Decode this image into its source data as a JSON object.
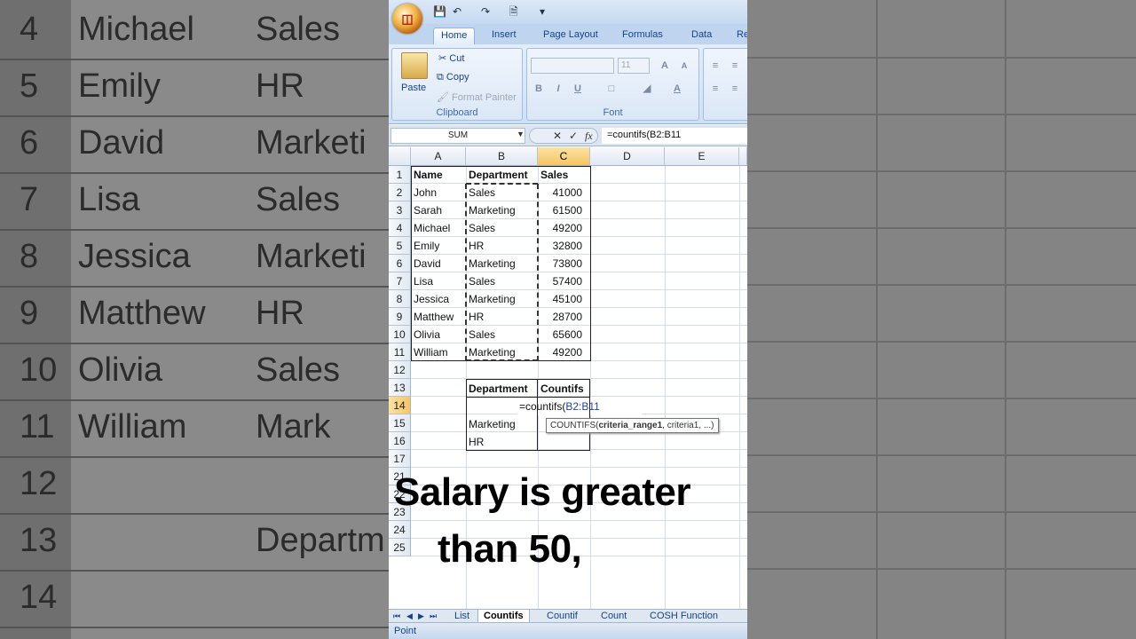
{
  "background": {
    "rows": [
      {
        "num": "4",
        "name": "Michael",
        "dept": "Sales"
      },
      {
        "num": "5",
        "name": "Emily",
        "dept": "HR"
      },
      {
        "num": "6",
        "name": "David",
        "dept": "Marketi"
      },
      {
        "num": "7",
        "name": "Lisa",
        "dept": "Sales"
      },
      {
        "num": "8",
        "name": "Jessica",
        "dept": "Marketi"
      },
      {
        "num": "9",
        "name": "Matthew",
        "dept": "HR"
      },
      {
        "num": "10",
        "name": "Olivia",
        "dept": "Sales"
      },
      {
        "num": "11",
        "name": "William",
        "dept": "Mark"
      },
      {
        "num": "12",
        "name": "",
        "dept": ""
      },
      {
        "num": "13",
        "name": "",
        "dept": "Departm"
      },
      {
        "num": "14",
        "name": "",
        "dept": ""
      }
    ]
  },
  "ribbon": {
    "tabs": [
      "Home",
      "Insert",
      "Page Layout",
      "Formulas",
      "Data",
      "Re"
    ],
    "clipboard": {
      "paste": "Paste",
      "cut": "Cut",
      "copy": "Copy",
      "format_painter": "Format Painter",
      "label": "Clipboard"
    },
    "font": {
      "size": "11",
      "label": "Font",
      "bold": "B",
      "italic": "I",
      "underline": "U",
      "grow": "A",
      "shrink": "A"
    }
  },
  "formula_bar": {
    "name_box": "SUM",
    "fx": "fx",
    "formula": "=countifs(B2:B11"
  },
  "grid": {
    "columns": [
      "A",
      "B",
      "C",
      "D",
      "E"
    ],
    "row_numbers": [
      "1",
      "2",
      "3",
      "4",
      "5",
      "6",
      "7",
      "8",
      "9",
      "10",
      "11",
      "12",
      "13",
      "14",
      "15",
      "16",
      "17",
      "21",
      "22",
      "23",
      "24",
      "25"
    ],
    "headers": {
      "name": "Name",
      "department": "Department",
      "sales": "Sales"
    },
    "rows": [
      {
        "name": "John",
        "dept": "Sales",
        "sales": "41000"
      },
      {
        "name": "Sarah",
        "dept": "Marketing",
        "sales": "61500"
      },
      {
        "name": "Michael",
        "dept": "Sales",
        "sales": "49200"
      },
      {
        "name": "Emily",
        "dept": "HR",
        "sales": "32800"
      },
      {
        "name": "David",
        "dept": "Marketing",
        "sales": "73800"
      },
      {
        "name": "Lisa",
        "dept": "Sales",
        "sales": "57400"
      },
      {
        "name": "Jessica",
        "dept": "Marketing",
        "sales": "45100"
      },
      {
        "name": "Matthew",
        "dept": "HR",
        "sales": "28700"
      },
      {
        "name": "Olivia",
        "dept": "Sales",
        "sales": "65600"
      },
      {
        "name": "William",
        "dept": "Marketing",
        "sales": "49200"
      }
    ],
    "summary": {
      "header_dept": "Department",
      "header_countifs": "Countifs",
      "editing_cell": "=countifs(",
      "editing_ref": "B2:B11",
      "row15": "Marketing",
      "row16": "HR"
    },
    "tooltip": {
      "fn": "COUNTIFS(",
      "arg1": "criteria_range1",
      "rest": ", criteria1, ...)"
    }
  },
  "overlay_text": {
    "line1": "Salary is greater",
    "line2": "than 50,"
  },
  "sheet_tabs": [
    "List",
    "Countifs",
    "Countif",
    "Count",
    "COSH Function"
  ],
  "active_sheet": "Countifs",
  "status": "Point"
}
